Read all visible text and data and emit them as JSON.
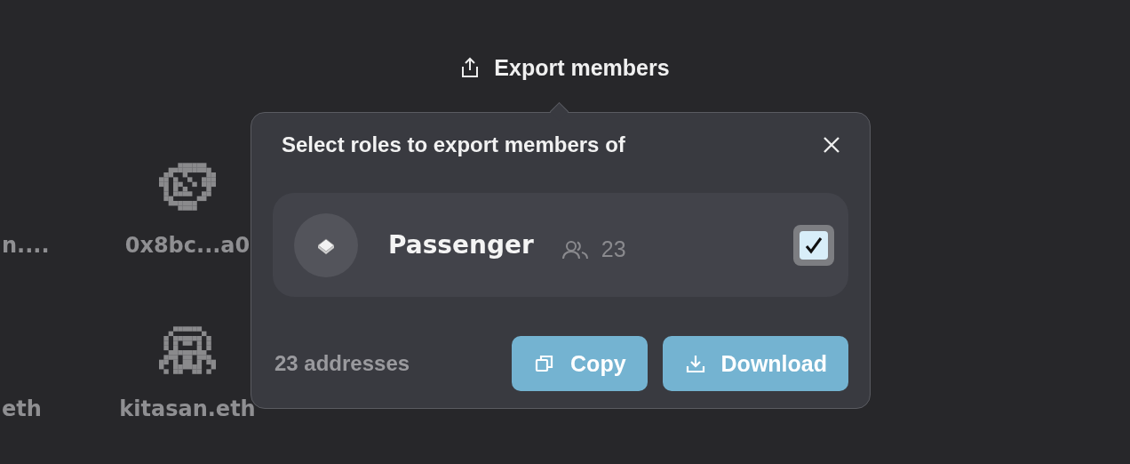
{
  "header": {
    "label": "Export members"
  },
  "members": [
    [
      {
        "name": "n...."
      },
      {
        "name": "0x8bc...a0",
        "kind": "cap"
      }
    ],
    [
      {
        "name": "eth"
      },
      {
        "name": "kitasan.eth",
        "kind": "hood"
      }
    ]
  ],
  "popover": {
    "title": "Select roles to export members of",
    "roles": [
      {
        "name": "Passenger",
        "count": "23",
        "checked": true
      }
    ],
    "summary": "23 addresses",
    "buttons": [
      {
        "label": "Copy",
        "kind": "copy"
      },
      {
        "label": "Download",
        "kind": "download"
      }
    ]
  }
}
